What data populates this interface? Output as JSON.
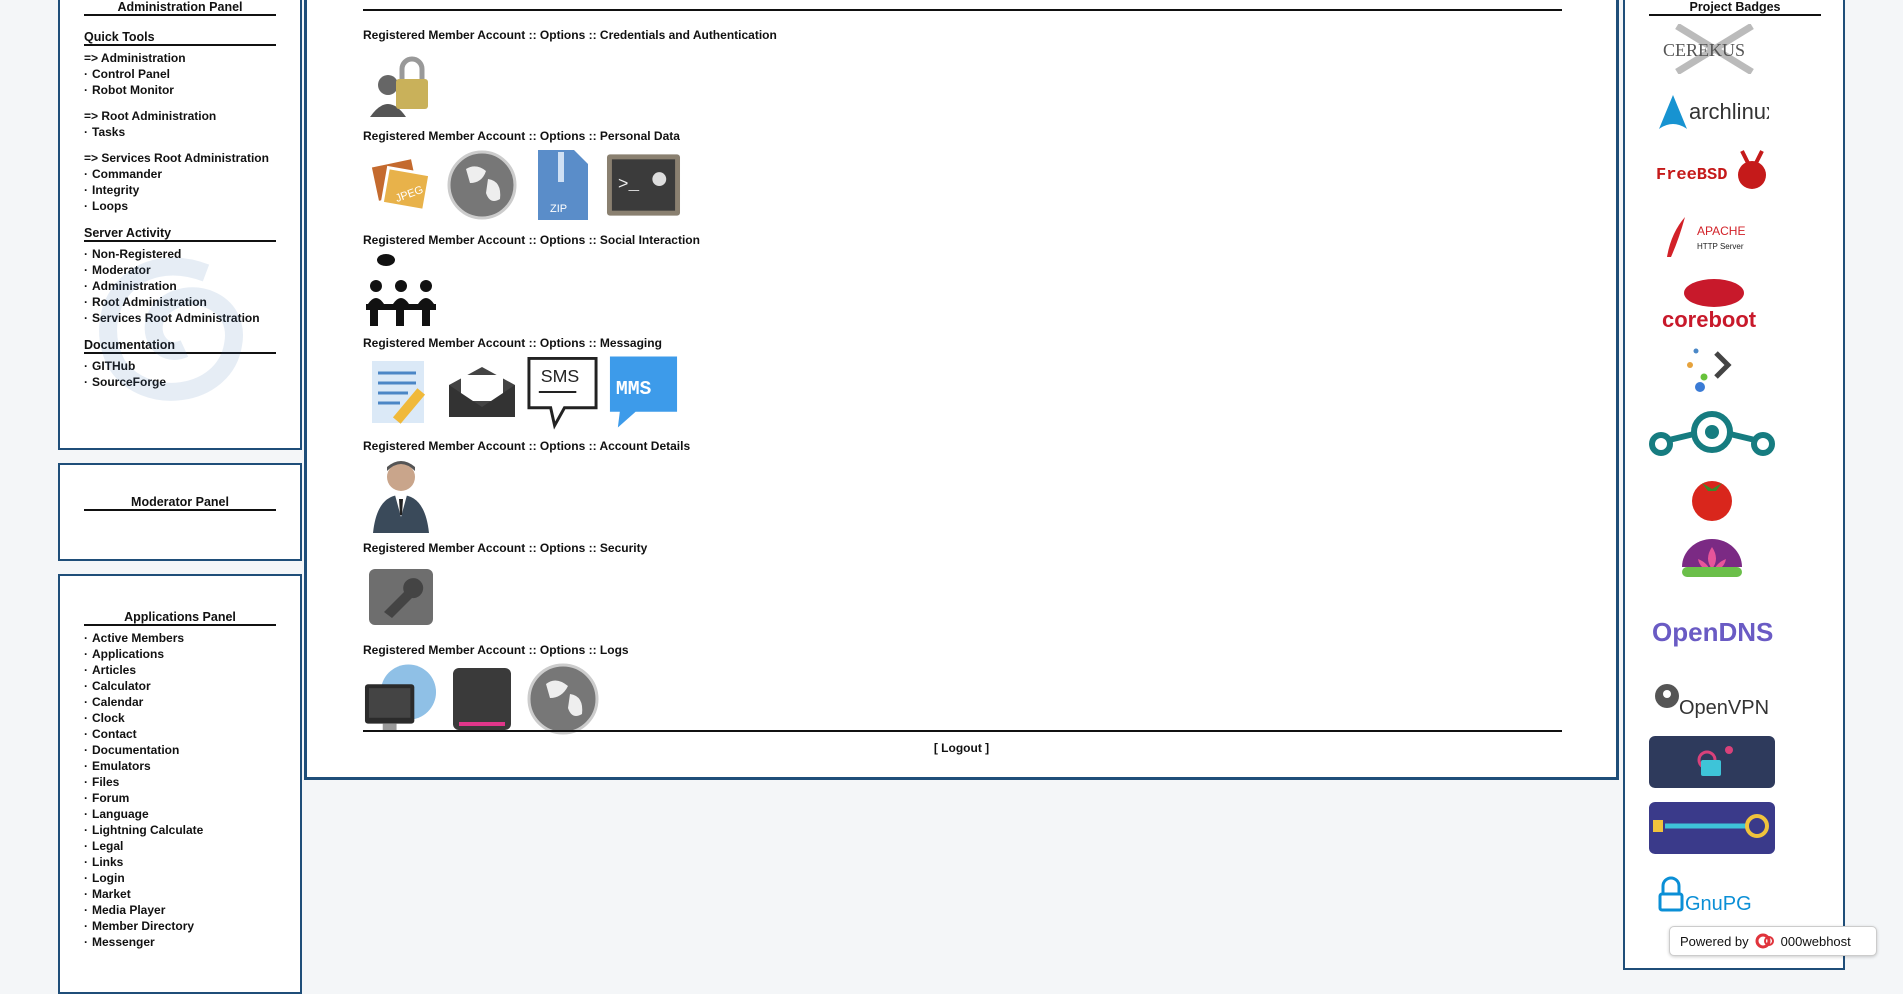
{
  "admin_panel": {
    "title": "Administration Panel",
    "quick_tools_heading": "Quick Tools",
    "groups": [
      {
        "header": "=> Administration",
        "items": [
          "Control Panel",
          "Robot Monitor"
        ]
      },
      {
        "header": "=> Root Administration",
        "items": [
          "Tasks"
        ]
      },
      {
        "header": "=> Services Root Administration",
        "items": [
          "Commander",
          "Integrity",
          "Loops"
        ]
      }
    ],
    "server_activity_heading": "Server Activity",
    "server_activity_items": [
      "Non-Registered",
      "Moderator",
      "Administration",
      "Root Administration",
      "Services Root Administration"
    ],
    "documentation_heading": "Documentation",
    "documentation_items": [
      "GITHub",
      "SourceForge"
    ]
  },
  "moderator_panel": {
    "title": "Moderator Panel"
  },
  "applications_panel": {
    "title": "Applications Panel",
    "items": [
      "Active Members",
      "Applications",
      "Articles",
      "Calculator",
      "Calendar",
      "Clock",
      "Contact",
      "Documentation",
      "Emulators",
      "Files",
      "Forum",
      "Language",
      "Lightning Calculate",
      "Legal",
      "Links",
      "Login",
      "Market",
      "Media Player",
      "Member Directory",
      "Messenger"
    ]
  },
  "main": {
    "sections": [
      {
        "title": "Registered Member Account :: Options :: Credentials and Authentication",
        "icons": [
          "user-lock-icon"
        ]
      },
      {
        "title": "Registered Member Account :: Options :: Personal Data",
        "icons": [
          "jpeg-images-icon",
          "globe-icon",
          "zip-file-icon",
          "terminal-icon"
        ]
      },
      {
        "title": "Registered Member Account :: Options :: Social Interaction",
        "icons": [
          "meeting-people-icon"
        ]
      },
      {
        "title": "Registered Member Account :: Options :: Messaging",
        "icons": [
          "notepad-pencil-icon",
          "envelope-icon",
          "sms-bubble-icon",
          "mms-bubble-icon"
        ]
      },
      {
        "title": "Registered Member Account :: Options :: Account Details",
        "icons": [
          "businessman-icon"
        ]
      },
      {
        "title": "Registered Member Account :: Options :: Security",
        "icons": [
          "wrench-icon"
        ]
      },
      {
        "title": "Registered Member Account :: Options :: Logs",
        "icons": [
          "monitor-globe-icon",
          "hard-drive-icon",
          "globe-icon"
        ]
      }
    ],
    "logout_open": "[ ",
    "logout_label": "Logout",
    "logout_close": " ]"
  },
  "badges_panel": {
    "title": "Project Badges",
    "badges": [
      "CEREKUS",
      "archlinux",
      "FreeBSD",
      "APACHE",
      "HTTP Server",
      "coreboot",
      "",
      "",
      "",
      "",
      "OpenDNS",
      "OpenVPN",
      "",
      "",
      "GnuPG"
    ]
  },
  "powered": {
    "label": "Powered by",
    "brand": "000webhost"
  }
}
